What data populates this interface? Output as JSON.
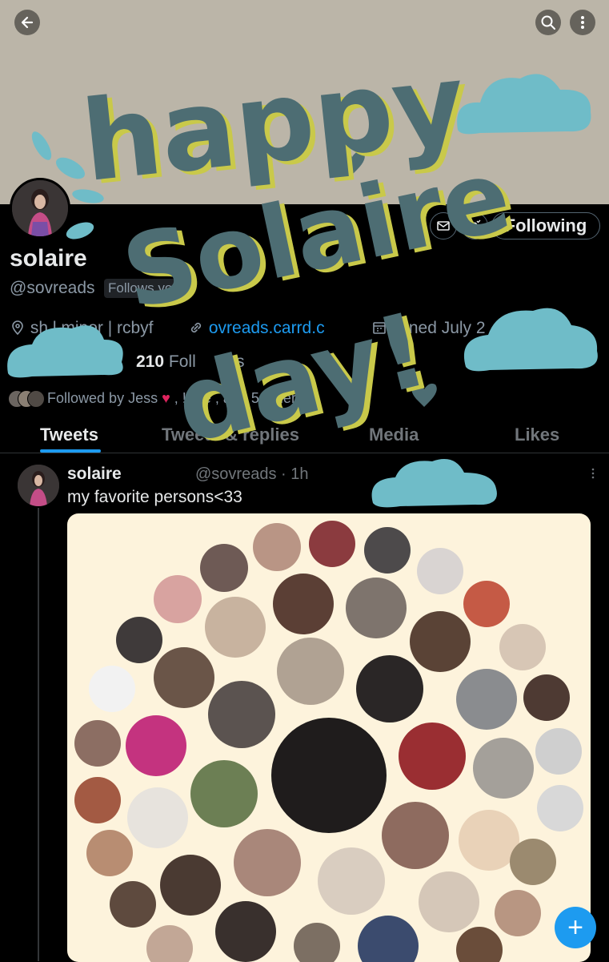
{
  "header": {
    "back_icon": "arrow-left-icon",
    "search_icon": "search-icon",
    "more_icon": "more-vertical-icon",
    "banner_color": "#bbb5a8"
  },
  "profile": {
    "name": "solaire",
    "handle": "@sovreads",
    "follows_you": "Follows you",
    "bio_location_fragment": "sh l minor | rcbyf",
    "link": "ovreads.carrd.c",
    "joined": "J ined July 2",
    "followers_count": "210",
    "followers_label": "Foll",
    "followers_label_tail": "rs",
    "following_count_partial": "g",
    "followed_by": "Followed by Jess",
    "followed_by_mid": ", !",
    "followed_by_name": "rae",
    "followed_by_tail": ", and 5 others",
    "following_button": "Following"
  },
  "tabs": [
    {
      "label": "Tweets",
      "active": true
    },
    {
      "label": "Tweets & replies",
      "active": false
    },
    {
      "label": "Media",
      "active": false
    },
    {
      "label": "Likes",
      "active": false
    }
  ],
  "tweet": {
    "name": "solaire",
    "handle": "@sovreads",
    "time": "· 1h",
    "text": "my favorite persons<33",
    "more_icon": "more-horizontal-icon"
  },
  "overlay_text": {
    "line1": "happy",
    "line2": "Solaire",
    "line3": "day!"
  },
  "colors": {
    "accent": "#1d9bf0",
    "doodle_teal": "#4d6d73",
    "doodle_yellow": "#c9c94a",
    "cloud": "#6fbcc8",
    "card_bg": "#fdf3dc"
  },
  "fab": {
    "label": "+"
  }
}
